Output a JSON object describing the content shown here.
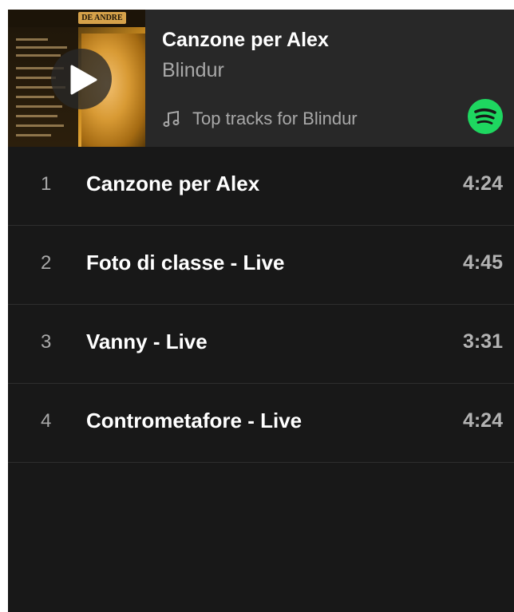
{
  "player": {
    "now_playing_title": "Canzone per Alex",
    "now_playing_artist": "Blindur",
    "playlist_label": "Top tracks for Blindur",
    "cover_band_text": "DE ANDRE",
    "icons": {
      "play": "play-icon",
      "note": "music-note-icon",
      "brand": "spotify-icon"
    },
    "colors": {
      "background": "#181818",
      "header": "#282828",
      "brand_green": "#1ED760"
    }
  },
  "tracks": [
    {
      "number": "1",
      "title": "Canzone per Alex",
      "duration": "4:24"
    },
    {
      "number": "2",
      "title": "Foto di classe - Live",
      "duration": "4:45"
    },
    {
      "number": "3",
      "title": "Vanny - Live",
      "duration": "3:31"
    },
    {
      "number": "4",
      "title": "Contrometafore - Live",
      "duration": "4:24"
    }
  ]
}
